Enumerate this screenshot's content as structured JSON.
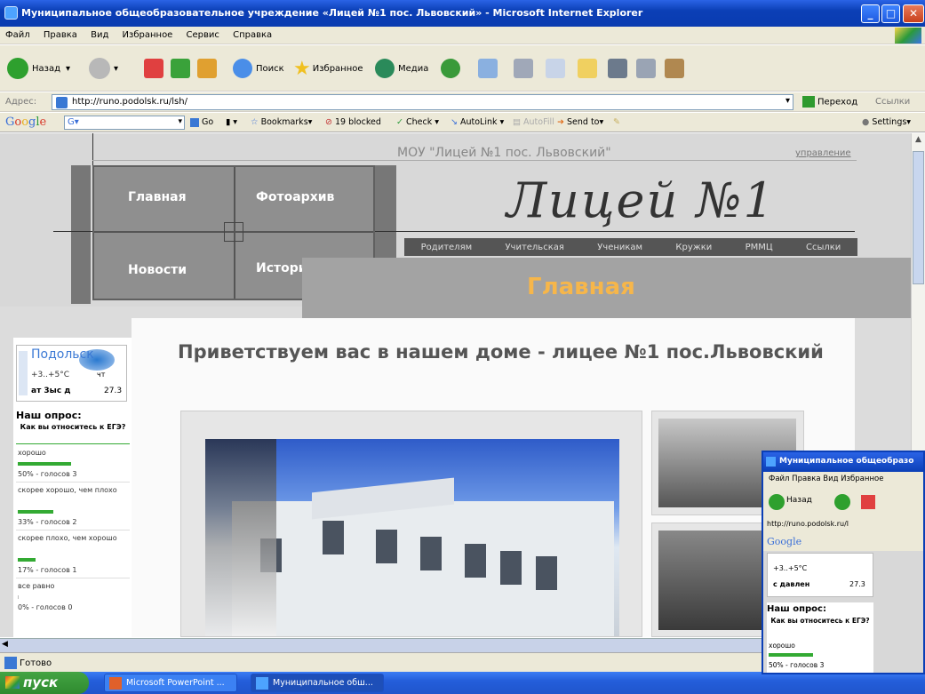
{
  "window": {
    "title": "Муниципальное общеобразовательное учреждение «Лицей №1 пос. Львовский» - Microsoft Internet Explorer",
    "min": "_",
    "max": "□",
    "close": "✕"
  },
  "menu": {
    "items": [
      "Файл",
      "Правка",
      "Вид",
      "Избранное",
      "Сервис",
      "Справка"
    ]
  },
  "toolbar": {
    "back": "Назад",
    "search": "Поиск",
    "favorites": "Избранное",
    "media": "Медиа"
  },
  "address": {
    "label": "Адрес:",
    "url": "http://runo.podolsk.ru/lsh/",
    "go": "Переход",
    "links": "Ссылки"
  },
  "googlebar": {
    "logo": "Google",
    "g_button": "G▾",
    "go": "Go",
    "bookmarks": "Bookmarks▾",
    "blocked": "19 blocked",
    "check": "Check ▾",
    "autolink": "AutoLink ▾",
    "autofill": "AutoFill",
    "sendto": "Send to▾",
    "settings": "Settings▾"
  },
  "site": {
    "title": "МОУ \"Лицей №1 пос. Львовский\"",
    "admin_link": "управление",
    "logo_text": "Лицей №1",
    "nav": {
      "main": "Главная",
      "photo": "Фотоархив",
      "news": "Новости",
      "history": "История"
    },
    "topnav": [
      "Родителям",
      "Учительская",
      "Ученикам",
      "Кружки",
      "РММЦ",
      "Ссылки"
    ],
    "section_title": "Главная",
    "welcome": "Приветствуем вас в нашем доме - лицее №1 пос.Львовский"
  },
  "weather": {
    "city": "Подольск",
    "temp": "+3..+5°C",
    "day": "чт",
    "date": "27.3",
    "note": "ат 3ыс д"
  },
  "poll": {
    "heading": "Наш опрос:",
    "question": "Как вы относитесь к ЕГЭ?",
    "options": [
      {
        "label": "хорошо",
        "result": "50% - голосов 3",
        "percent": 50
      },
      {
        "label": "скорее хорошо, чем плохо",
        "result": "33% - голосов 2",
        "percent": 33
      },
      {
        "label": "скорее плохо, чем хорошо",
        "result": "17% - голосов 1",
        "percent": 17
      },
      {
        "label": "все равно",
        "result": "0% - голосов 0",
        "percent": 0
      }
    ]
  },
  "status": {
    "text": "Готово"
  },
  "taskbar": {
    "start": "пуск",
    "tasks": [
      "Microsoft PowerPoint ...",
      "Муниципальное обш..."
    ]
  },
  "overlay": {
    "title": "Муниципальное общеобразо",
    "menu": "Файл  Правка  Вид  Избранное",
    "back": "Назад",
    "address": "http://runo.podolsk.ru/l",
    "google": "Google",
    "weather_temp": "+3..+5°C",
    "weather_date": "27.3",
    "weather_note": "с давлен",
    "poll_heading": "Наш опрос:",
    "poll_question": "Как вы относитесь к ЕГЭ?",
    "opt1": "хорошо",
    "opt1_result": "50% - голосов 3"
  },
  "colors": {
    "accent": "#f6b64a",
    "titlebar": "#0b3fb6",
    "poll_bar": "#33aa33"
  }
}
